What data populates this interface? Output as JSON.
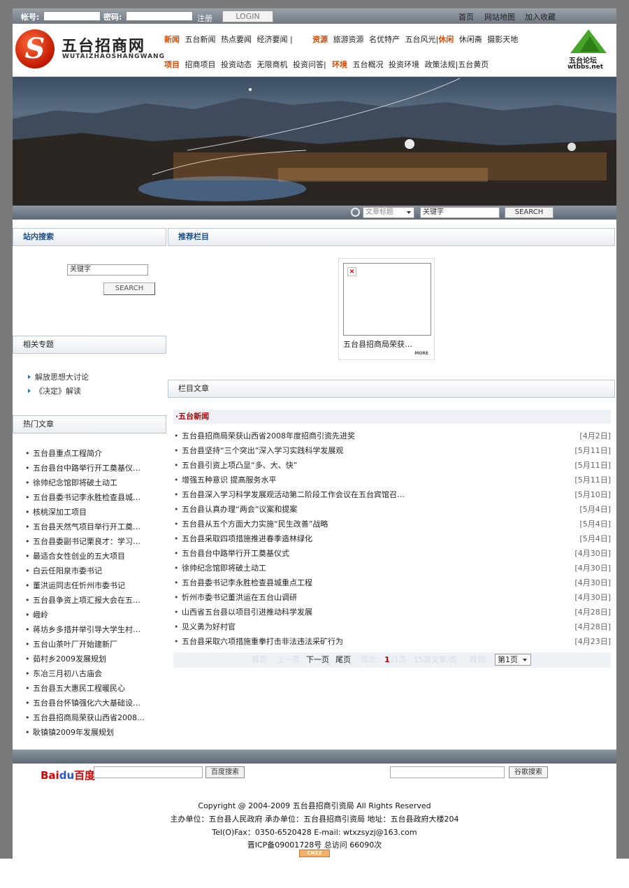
{
  "topbar": {
    "account_label": "帐号:",
    "password_label": "密码:",
    "register": "注册",
    "login": "LOGIN",
    "links": [
      "首页",
      "网站地图",
      "加入收藏"
    ]
  },
  "header": {
    "logo_title": "五台招商网",
    "logo_sub": "WUTAIZHAOSHANGWANG",
    "nav_rows": [
      {
        "head": "新闻",
        "items": [
          "五台新闻",
          "热点要闻",
          "经济要闻 |"
        ]
      },
      {
        "head": "资源",
        "items": [
          "旅游资源",
          "名优特产",
          "五台风光|"
        ]
      },
      {
        "head": "休闲",
        "items": [
          "休闲斋",
          "摄影天地"
        ]
      },
      {
        "head": "项目",
        "items": [
          "招商项目",
          "投资动态",
          "无限商机",
          "投资问答|"
        ]
      },
      {
        "head": "环境",
        "items": [
          "五台概况",
          "投资环境",
          "政策法规|五台黄页"
        ]
      }
    ],
    "forum_name": "五台论坛",
    "forum_domain": "wtbbs.net"
  },
  "banner_search": {
    "select_value": "文章标题",
    "keyword": "关键字",
    "button": "SEARCH"
  },
  "sidebar": {
    "site_search_title": "站内搜索",
    "keyword": "关键字",
    "search_button": "SEARCH",
    "topics_title": "相关专题",
    "topics": [
      "解放思想大讨论",
      "《决定》解读"
    ],
    "hot_title": "热门文章",
    "hot_articles": [
      "五台县重点工程简介",
      "五台县台中路举行开工奠基仪…",
      "徐帅纪念馆即将破土动工",
      "五台县委书记李永胜检查县城…",
      "核桃深加工项目",
      "五台县天然气项目举行开工奠…",
      "五台县委副书记栗良才：学习…",
      "最适合女性创业的五大项目",
      "白云任阳泉市委书记",
      "董洪运同志任忻州市委书记",
      "五台县争资上项汇报大会在五…",
      "峨岭",
      "蒋坊乡多措并举引导大学生村…",
      "五台山茶叶厂开始建新厂",
      "茹村乡2009发展规划",
      "东冶三月初八古庙会",
      "五台县五大惠民工程暖民心",
      "五台县台怀镇强化六大基础设…",
      "五台县招商局荣获山西省2008…",
      "耿镇镇2009年发展规划"
    ]
  },
  "main": {
    "recommend_title": "推荐栏目",
    "recommend_caption": "五台县招商局荣获…",
    "recommend_more": "MORE",
    "column_title": "栏目文章",
    "news_header": "·五台新闻",
    "news": [
      {
        "title": "五台县招商局荣获山西省2008年度招商引资先进奖",
        "date": "[4月2日]"
      },
      {
        "title": "五台县坚持“三个突出”深入学习实践科学发展观",
        "date": "[5月11日]"
      },
      {
        "title": "五台县引资上项凸显“多、大、快”",
        "date": "[5月11日]"
      },
      {
        "title": "增强五种意识 提高服务水平",
        "date": "[5月11日]"
      },
      {
        "title": "五台县深入学习科学发展观活动第二阶段工作会议在五台宾馆召…",
        "date": "[5月10日]"
      },
      {
        "title": "五台县认真办理“两会”议案和提案",
        "date": "[5月4日]"
      },
      {
        "title": "五台县从五个方面大力实施“民生改善”战略",
        "date": "[5月4日]"
      },
      {
        "title": "五台县采取四项措施推进春季造林绿化",
        "date": "[5月4日]"
      },
      {
        "title": "五台县台中路举行开工奠基仪式",
        "date": "[4月30日]"
      },
      {
        "title": "徐帅纪念馆即将破土动工",
        "date": "[4月30日]"
      },
      {
        "title": "五台县委书记李永胜检查县城重点工程",
        "date": "[4月30日]"
      },
      {
        "title": "忻州市委书记董洪运在五台山调研",
        "date": "[4月30日]"
      },
      {
        "title": "山西省五台县以项目引进推动科学发展",
        "date": "[4月28日]"
      },
      {
        "title": "见义勇为好村官",
        "date": "[4月28日]"
      },
      {
        "title": "五台县采取六项措施重拳打击非法违法采矿行为",
        "date": "[4月23日]"
      }
    ],
    "pager": {
      "first": "首页",
      "prev": "上一页",
      "next": "下一页",
      "last": "尾页",
      "page_label": "页次:",
      "current": "1",
      "total": "/1页",
      "per_page": "15篇文章/页",
      "goto": "转到:",
      "select": "第1页"
    }
  },
  "footer": {
    "baidu_b1": "Bai",
    "baidu_paw": "du",
    "baidu_b2": "百度",
    "baidu_button": "百度搜索",
    "google_button": "谷歌搜索",
    "copyright": "Copyright @ 2004-2009 五台县招商引资局 All Rights Reserved",
    "sponsor": "主办单位：五台县人民政府   承办单位：五台县招商引资局    地址：五台县政府大楼204",
    "contact": "Tel(O)Fax：0350-6520428 E-mail: wtxzsyzj@163.com",
    "icp": "晋ICP备09001728号   总访问 66090次",
    "cnzz": "CNZZ"
  }
}
